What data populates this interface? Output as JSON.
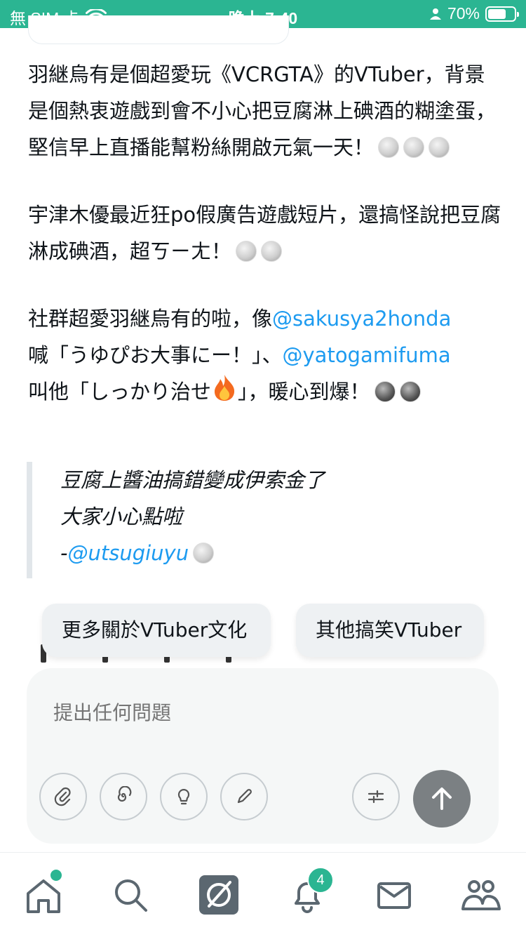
{
  "status_bar": {
    "carrier": "無 SIM 卡",
    "time": "晚上 7:40",
    "battery": "70%",
    "battery_level": 0.7
  },
  "post": {
    "para1": "羽継烏有是個超愛玩《VCRGTA》的VTuber，背景是個熱衷遊戲到會不小心把豆腐淋上碘酒的糊塗蛋，堅信早上直播能幫粉絲開啟元氣一天！",
    "para2": "宇津木優最近狂po假廣告遊戲短片，還搞怪說把豆腐淋成碘酒，超ㄎㄧㄤ！",
    "para3_a": "社群超愛羽継烏有的啦，像",
    "mention1": "@sakusya2honda",
    "para3_b": "喊「うゆぴお大事にー！」、",
    "mention2": "@yatogamifuma",
    "para3_c": "叫他「しっかり治せ",
    "para3_d": "」，暖心到爆！",
    "quote_line1": "豆腐上醬油搞錯變成伊索金了",
    "quote_line2": "大家小心點啦",
    "quote_dash": "-",
    "quote_mention": "@utsugiuyu"
  },
  "suggestions": [
    "更多關於VTuber文化",
    "其他搞笑VTuber"
  ],
  "composer": {
    "placeholder": "提出任何問題",
    "tools": [
      "paperclip-icon",
      "spiral-icon",
      "lightbulb-icon",
      "pen-icon",
      "sliders-icon"
    ]
  },
  "bottom_nav": {
    "notifications_count": "4",
    "items": [
      "home-icon",
      "search-icon",
      "grok-icon",
      "bell-icon",
      "mail-icon",
      "communities-icon"
    ]
  },
  "colors": {
    "accent": "#2bb592",
    "link": "#1d9bf0",
    "send": "#7b8083"
  }
}
